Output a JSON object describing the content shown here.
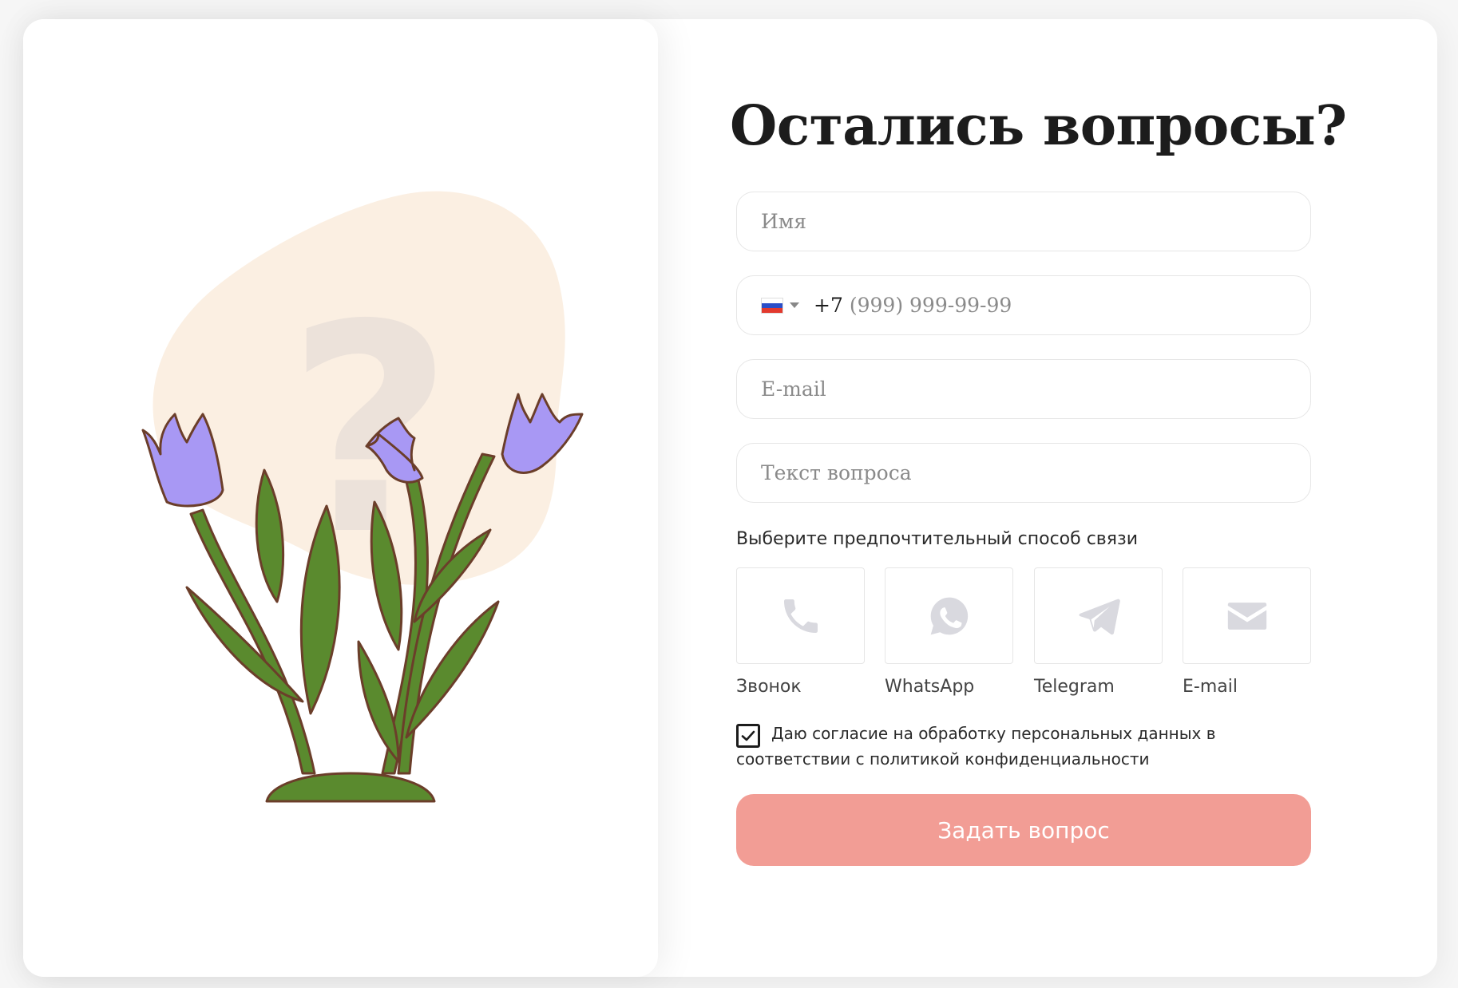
{
  "title": "Остались вопросы?",
  "form": {
    "name_placeholder": "Имя",
    "phone": {
      "country": "RU",
      "dial_code": "+7",
      "placeholder": "(999) 999-99-99"
    },
    "email_placeholder": "E-mail",
    "question_placeholder": "Текст вопроса"
  },
  "contact_method": {
    "label": "Выберите предпочтительный способ связи",
    "options": [
      {
        "label": "Звонок",
        "icon": "phone-icon"
      },
      {
        "label": "WhatsApp",
        "icon": "whatsapp-icon"
      },
      {
        "label": "Telegram",
        "icon": "telegram-icon"
      },
      {
        "label": "E-mail",
        "icon": "mail-icon"
      }
    ]
  },
  "consent": {
    "checked": true,
    "text": "Даю согласие на обработку персональных данных в соответствии с политикой конфиденциальности"
  },
  "submit_label": "Задать вопрос",
  "colors": {
    "accent": "#f29d95",
    "blob": "#fbefe2",
    "petal": "#a898f4",
    "leaf": "#5a8a2e",
    "outline": "#6b3e2a",
    "icon": "#d9d9df"
  }
}
